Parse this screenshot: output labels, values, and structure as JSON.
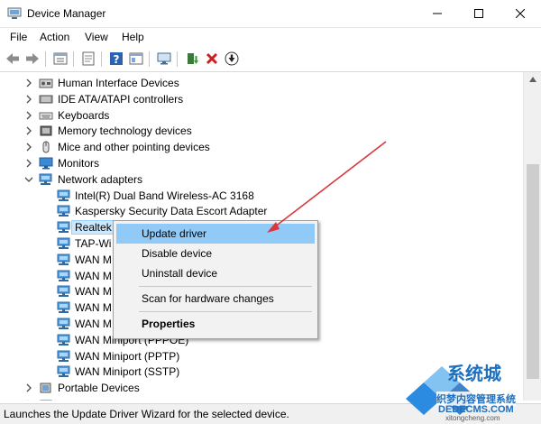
{
  "window": {
    "title": "Device Manager",
    "icons": {
      "app": "device-manager-icon",
      "minimize": "minimize-icon",
      "maximize": "maximize-icon",
      "close": "close-icon"
    }
  },
  "menubar": {
    "items": [
      "File",
      "Action",
      "View",
      "Help"
    ]
  },
  "toolbar": {
    "buttons": [
      "back-arrow-icon",
      "forward-arrow-icon",
      "properties-list-icon",
      "show-hidden-icon",
      "help-icon",
      "details-icon",
      "monitor-icon",
      "update-driver-icon",
      "uninstall-x-icon",
      "download-icon"
    ]
  },
  "tree": {
    "rows": [
      {
        "label": "Human Interface Devices",
        "type": "category",
        "expanded": false,
        "icon": "hid-icon"
      },
      {
        "label": "IDE ATA/ATAPI controllers",
        "type": "category",
        "expanded": false,
        "icon": "ide-controller-icon"
      },
      {
        "label": "Keyboards",
        "type": "category",
        "expanded": false,
        "icon": "keyboard-icon"
      },
      {
        "label": "Memory technology devices",
        "type": "category",
        "expanded": false,
        "icon": "memory-device-icon"
      },
      {
        "label": "Mice and other pointing devices",
        "type": "category",
        "expanded": false,
        "icon": "mouse-icon"
      },
      {
        "label": "Monitors",
        "type": "category",
        "expanded": false,
        "icon": "monitor-icon"
      },
      {
        "label": "Network adapters",
        "type": "category",
        "expanded": true,
        "icon": "network-adapter-icon"
      },
      {
        "label": "Intel(R) Dual Band Wireless-AC 3168",
        "type": "device",
        "icon": "network-adapter-icon"
      },
      {
        "label": "Kaspersky Security Data Escort Adapter",
        "type": "device",
        "icon": "network-adapter-icon"
      },
      {
        "label": "Realtek",
        "type": "device",
        "selected": true,
        "icon": "network-adapter-icon"
      },
      {
        "label": "TAP-Wi",
        "type": "device",
        "icon": "network-adapter-icon"
      },
      {
        "label": "WAN M",
        "type": "device",
        "icon": "network-adapter-icon"
      },
      {
        "label": "WAN M",
        "type": "device",
        "icon": "network-adapter-icon"
      },
      {
        "label": "WAN M",
        "type": "device",
        "icon": "network-adapter-icon"
      },
      {
        "label": "WAN M",
        "type": "device",
        "icon": "network-adapter-icon"
      },
      {
        "label": "WAN M",
        "type": "device",
        "icon": "network-adapter-icon"
      },
      {
        "label": "WAN Miniport (PPPOE)",
        "type": "device",
        "icon": "network-adapter-icon"
      },
      {
        "label": "WAN Miniport (PPTP)",
        "type": "device",
        "icon": "network-adapter-icon"
      },
      {
        "label": "WAN Miniport (SSTP)",
        "type": "device",
        "icon": "network-adapter-icon"
      },
      {
        "label": "Portable Devices",
        "type": "category",
        "expanded": false,
        "icon": "portable-device-icon"
      },
      {
        "label": "",
        "type": "category",
        "expanded": false,
        "icon": "printer-queue-icon"
      }
    ]
  },
  "context_menu": {
    "items": [
      {
        "label": "Update driver",
        "highlighted": true
      },
      {
        "label": "Disable device"
      },
      {
        "label": "Uninstall device"
      },
      {
        "separator": true
      },
      {
        "label": "Scan for hardware changes"
      },
      {
        "separator": true
      },
      {
        "label": "Properties",
        "bold": true
      }
    ]
  },
  "status": {
    "text": "Launches the Update Driver Wizard for the selected device."
  },
  "watermark": {
    "line1": "系统城",
    "line2": "织梦内容管理系统",
    "line3": "DEDECMS.COM",
    "line4": "xitongcheng.com"
  },
  "colors": {
    "selection": "#cce8ff",
    "highlight": "#91c9f7",
    "arrow": "#d9363e",
    "watermark": "#1d6fbf"
  }
}
